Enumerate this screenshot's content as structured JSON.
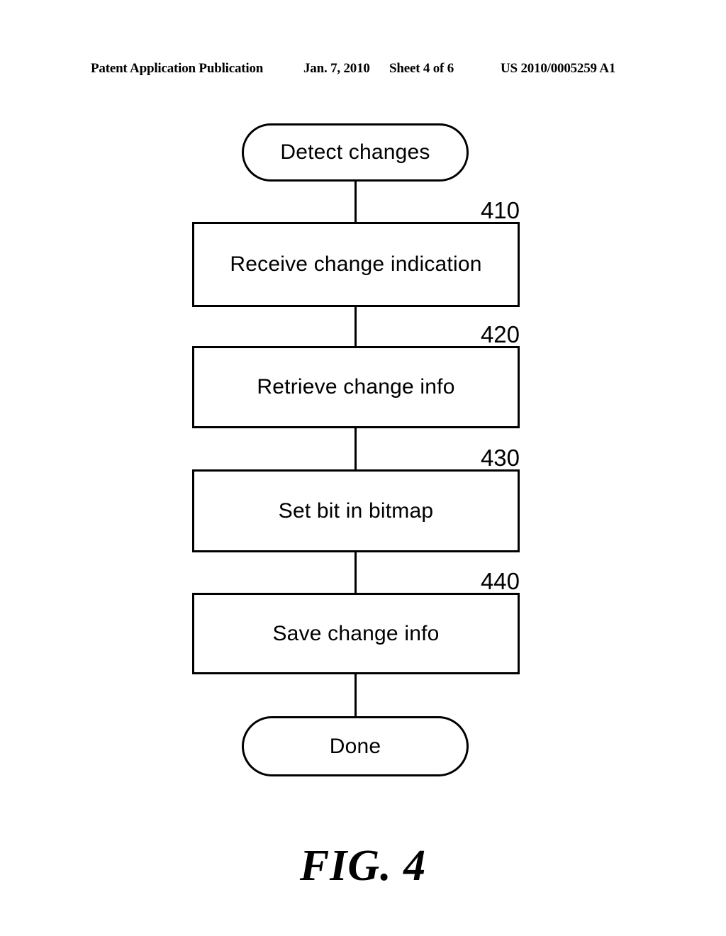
{
  "header": {
    "publication": "Patent Application Publication",
    "date": "Jan. 7, 2010",
    "sheet": "Sheet 4 of 6",
    "patent_number": "US 2010/0005259 A1"
  },
  "figure": {
    "caption": "FIG. 4",
    "number": "4"
  },
  "flowchart": {
    "start": {
      "label": "Detect changes",
      "shape": "terminator"
    },
    "steps": [
      {
        "label": "Receive change indication",
        "ref": "410",
        "shape": "process"
      },
      {
        "label": "Retrieve change info",
        "ref": "420",
        "shape": "process"
      },
      {
        "label": "Set bit in bitmap",
        "ref": "430",
        "shape": "process"
      },
      {
        "label": "Save change info",
        "ref": "440",
        "shape": "process"
      }
    ],
    "end": {
      "label": "Done",
      "shape": "terminator"
    }
  },
  "colors": {
    "ink": "#000000",
    "paper": "#ffffff"
  }
}
